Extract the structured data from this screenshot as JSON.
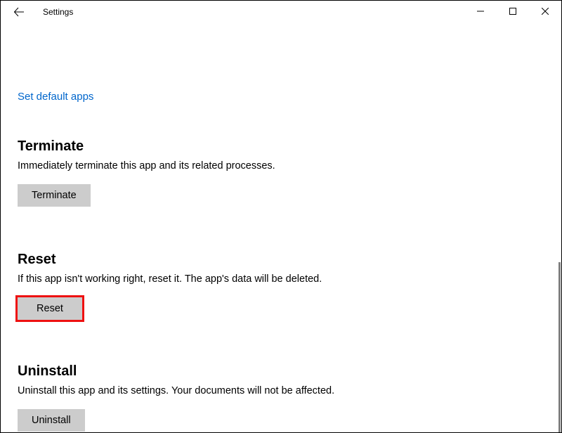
{
  "window": {
    "title": "Settings"
  },
  "link_default_apps": "Set default apps",
  "sections": {
    "terminate": {
      "heading": "Terminate",
      "description": "Immediately terminate this app and its related processes.",
      "button": "Terminate"
    },
    "reset": {
      "heading": "Reset",
      "description": "If this app isn't working right, reset it. The app's data will be deleted.",
      "button": "Reset"
    },
    "uninstall": {
      "heading": "Uninstall",
      "description": "Uninstall this app and its settings. Your documents will not be affected.",
      "button": "Uninstall"
    }
  }
}
